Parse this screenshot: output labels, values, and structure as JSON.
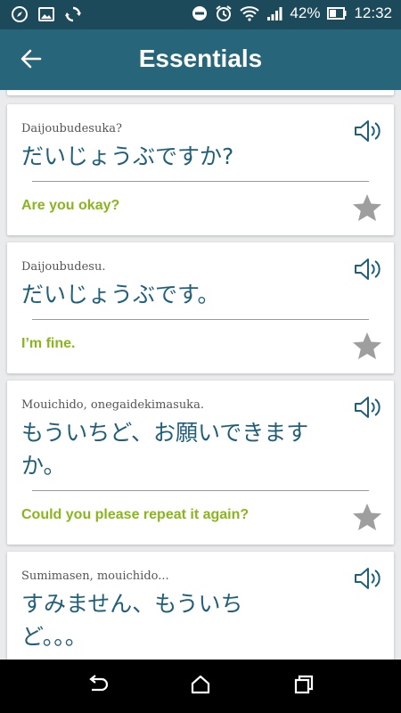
{
  "status_bar": {
    "battery_percent": "42%",
    "time": "12:32"
  },
  "header": {
    "title": "Essentials"
  },
  "cards": [
    {
      "romaji": "Daijoubudesuka?",
      "japanese": "だいじょうぶですか?",
      "english": "Are you okay?"
    },
    {
      "romaji": "Daijoubudesu.",
      "japanese": "だいじょうぶです。",
      "english": "I’m fine."
    },
    {
      "romaji": "Mouichido, onegaidekimasuka.",
      "japanese": "もういちど、お願いできますか。",
      "english": "Could you please repeat it again?"
    },
    {
      "romaji": "Sumimasen, mouichido...",
      "japanese": "すみません、もういちど。。。",
      "english": ""
    }
  ],
  "colors": {
    "status_bar": "#1d4a5a",
    "app_bar": "#27657a",
    "japanese_text": "#1f5f7a",
    "english_text": "#8ab51d",
    "star": "#9e9e9e",
    "background": "#e9ebec"
  },
  "icons": {
    "back": "arrow-left-icon",
    "speaker": "speaker-icon",
    "favorite": "star-icon",
    "nav_back": "nav-back-icon",
    "nav_home": "nav-home-icon",
    "nav_recents": "nav-recents-icon"
  }
}
